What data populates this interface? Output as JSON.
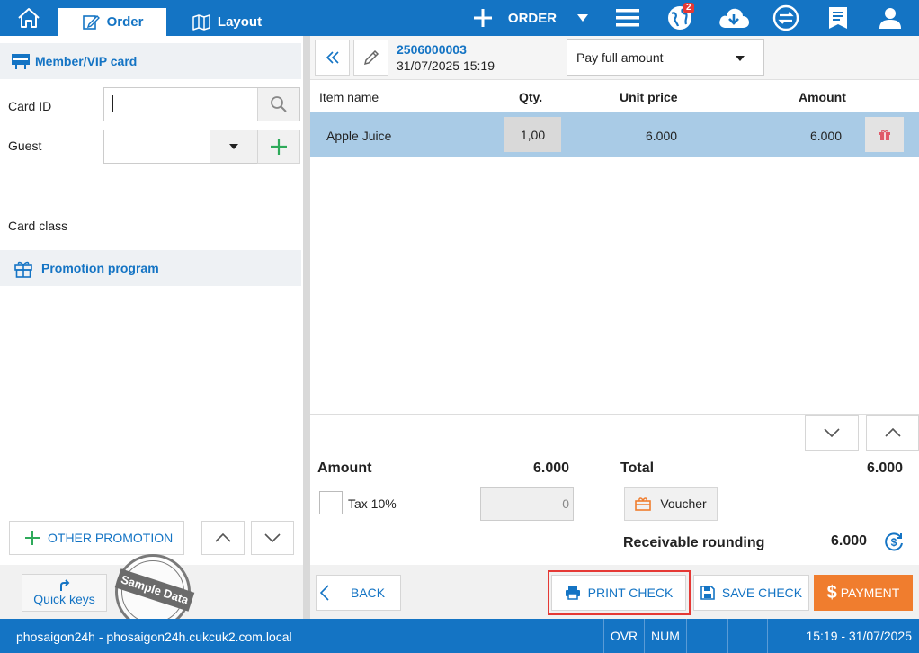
{
  "topbar": {
    "tabs": [
      {
        "label": "Order"
      },
      {
        "label": "Layout"
      }
    ],
    "order_label": "ORDER",
    "notification_count": "2"
  },
  "left": {
    "member_title": "Member/VIP card",
    "card_id_label": "Card ID",
    "card_id_value": "",
    "guest_label": "Guest",
    "guest_value": "",
    "card_class_label": "Card class",
    "promotion_title": "Promotion program",
    "other_promotion_label": "OTHER PROMOTION",
    "quick_keys_label": "Quick keys",
    "stamp_text": "Sample Data"
  },
  "order": {
    "number": "2506000003",
    "datetime": "31/07/2025 15:19",
    "payment_mode": "Pay full amount",
    "columns": [
      "Item name",
      "Qty.",
      "Unit price",
      "Amount"
    ],
    "rows": [
      {
        "name": "Apple Juice",
        "qty": "1,00",
        "unit_price": "6.000",
        "amount": "6.000"
      }
    ]
  },
  "summary": {
    "amount_label": "Amount",
    "amount_value": "6.000",
    "tax_label": "Tax 10%",
    "tax_value": "0",
    "total_label": "Total",
    "total_value": "6.000",
    "voucher_label": "Voucher",
    "rounding_label": "Receivable rounding",
    "rounding_value": "6.000"
  },
  "actions": {
    "back": "BACK",
    "print": "PRINT CHECK",
    "save": "SAVE CHECK",
    "payment": "PAYMENT"
  },
  "statusbar": {
    "server": "phosaigon24h - phosaigon24h.cukcuk2.com.local",
    "ovr": "OVR",
    "num": "NUM",
    "datetime": "15:19 - 31/07/2025"
  },
  "colors": {
    "brand": "#1474c4",
    "selected_row": "#a9cbe6",
    "payment": "#f07d2e",
    "highlight": "#e53935",
    "add_green": "#2eaa5a"
  }
}
